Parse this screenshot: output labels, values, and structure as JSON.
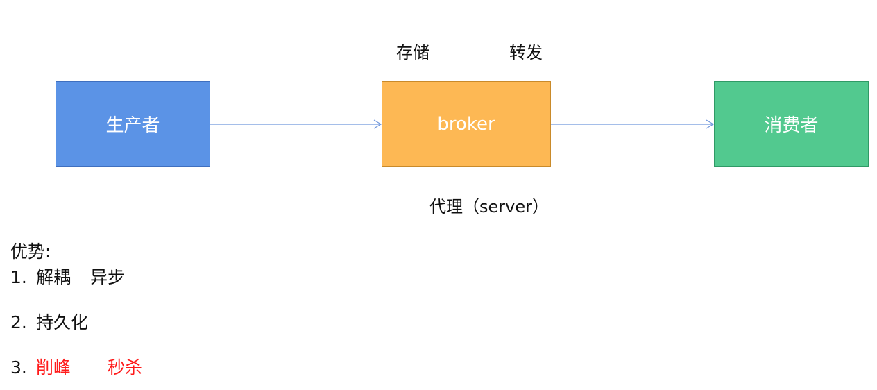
{
  "colors": {
    "producer": "#5b93e6",
    "broker": "#fdb854",
    "consumer": "#52c98f",
    "highlight": "#ff1a1a",
    "arrow": "#6f96dc"
  },
  "diagram": {
    "producer_label": "生产者",
    "broker_label": "broker",
    "consumer_label": "消费者",
    "top_label_store": "存储",
    "top_label_forward": "转发",
    "bottom_label": "代理（server）"
  },
  "advantages": {
    "title": "优势:",
    "items": [
      {
        "number": "1.",
        "parts": [
          "解耦",
          "异步"
        ]
      },
      {
        "number": "2.",
        "parts": [
          "持久化"
        ]
      },
      {
        "number": "3.",
        "parts": [
          "削峰",
          "秒杀"
        ]
      }
    ]
  }
}
